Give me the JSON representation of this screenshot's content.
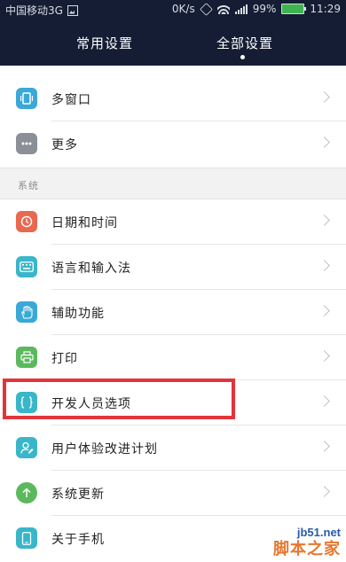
{
  "status_bar": {
    "carrier": "中国移动3G",
    "speed": "0K/s",
    "network_badge": "3G",
    "battery": "99%",
    "time": "11:29",
    "battery_color": "#3fb34f"
  },
  "tabs": {
    "common_label": "常用设置",
    "all_label": "全部设置",
    "active": "all"
  },
  "list_top": [
    {
      "label": "多窗口",
      "icon": "multi-window-icon",
      "color": "#3aa8d8"
    },
    {
      "label": "更多",
      "icon": "more-icon",
      "color": "#8a8f98"
    }
  ],
  "section": {
    "title": "系统"
  },
  "list_system": [
    {
      "label": "日期和时间",
      "icon": "clock-icon",
      "color": "#e9694f"
    },
    {
      "label": "语言和输入法",
      "icon": "keyboard-icon",
      "color": "#3ab6c9"
    },
    {
      "label": "辅助功能",
      "icon": "hand-icon",
      "color": "#3aa8d8"
    },
    {
      "label": "打印",
      "icon": "printer-icon",
      "color": "#5cb85c"
    },
    {
      "label": "开发人员选项",
      "icon": "braces-icon",
      "color": "#3ab6c9"
    },
    {
      "label": "用户体验改进计划",
      "icon": "user-edit-icon",
      "color": "#3ab6c9"
    },
    {
      "label": "系统更新",
      "icon": "arrow-up-icon",
      "color": "#5cb85c"
    },
    {
      "label": "关于手机",
      "icon": "phone-icon",
      "color": "#3ab6c9"
    }
  ],
  "highlight_color": "#e3343a",
  "watermark": {
    "domain": "jb51.net",
    "text": "脚本之家"
  }
}
